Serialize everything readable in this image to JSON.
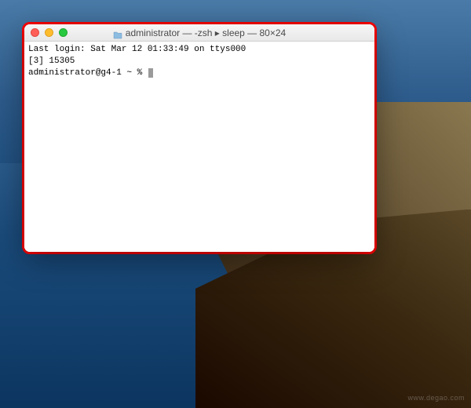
{
  "desktop": {
    "watermark": "www.degao.com"
  },
  "window": {
    "title": "administrator — -zsh ▸ sleep — 80×24",
    "folder_icon_color": "#6fa8d8"
  },
  "terminal": {
    "lines": {
      "last_login": "Last login: Sat Mar 12 01:33:49 on ttys000",
      "job_line": "[3] 15305",
      "prompt": "administrator@g4-1 ~ % "
    }
  },
  "colors": {
    "highlight": "#ff0000",
    "close": "#ff5f57",
    "minimize": "#ffbd2e",
    "maximize": "#28c940"
  }
}
